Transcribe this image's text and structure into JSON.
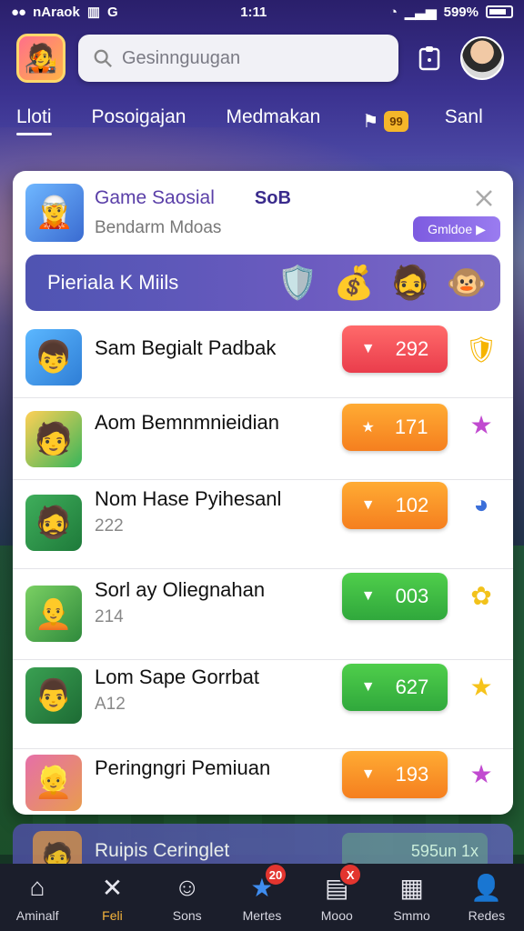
{
  "status_bar": {
    "carrier": "nAraok",
    "time": "1:11",
    "battery": "599%"
  },
  "search": {
    "placeholder": "Gesinnguugan"
  },
  "tabs": [
    {
      "label": "Lloti",
      "active": true
    },
    {
      "label": "Posoigajan",
      "active": false
    },
    {
      "label": "Medmakan",
      "active": false
    },
    {
      "label": "99",
      "active": false
    },
    {
      "label": "Sanl",
      "active": false
    }
  ],
  "card": {
    "title": "Game Saosial",
    "tag": "SoB",
    "subtitle": "Bendarm Mdoas",
    "open_label": "Gmldoe",
    "banner_title": "Pieriala K Miils"
  },
  "rows": [
    {
      "name": "Sam Begialt Padbak",
      "sub": "",
      "value": "292",
      "color": "red",
      "side_icon": "yellow-shield-icon"
    },
    {
      "name": "Aom Bemnmnieidian",
      "sub": "",
      "value": "171",
      "color": "orange",
      "side_icon": "purple-star-icon"
    },
    {
      "name": "Nom Hase Pyihesanl",
      "sub": "222",
      "value": "102",
      "color": "orange",
      "side_icon": "blue-orb-icon"
    },
    {
      "name": "Sorl ay Oliegnahan",
      "sub": "214",
      "value": "003",
      "color": "green",
      "side_icon": "yellow-star-icon"
    },
    {
      "name": "Lom Sape Gorrbat",
      "sub": "A12",
      "value": "627",
      "color": "green",
      "side_icon": "gold-star-icon"
    },
    {
      "name": "Peringngri Pemiuan",
      "sub": "",
      "value": "193",
      "color": "orange",
      "side_icon": "purple-star-icon"
    }
  ],
  "peek": {
    "title": "Ruipis Ceringlet",
    "pill": "595un 1x"
  },
  "bottom_nav": [
    {
      "label": "Aminalf",
      "icon": "home-icon",
      "active": false,
      "badge": ""
    },
    {
      "label": "Feli",
      "icon": "tools-icon",
      "active": true,
      "badge": ""
    },
    {
      "label": "Sons",
      "icon": "face-icon",
      "active": false,
      "badge": ""
    },
    {
      "label": "Mertes",
      "icon": "star-icon",
      "active": false,
      "badge": "20"
    },
    {
      "label": "Mooo",
      "icon": "inbox-icon",
      "active": false,
      "badge": "X"
    },
    {
      "label": "Smmo",
      "icon": "calendar-icon",
      "active": false,
      "badge": ""
    },
    {
      "label": "Redes",
      "icon": "profile-icon",
      "active": false,
      "badge": ""
    }
  ]
}
